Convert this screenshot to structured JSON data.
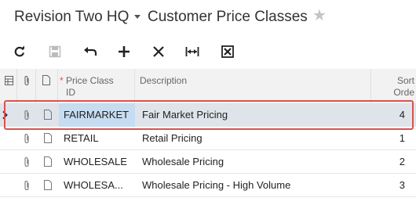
{
  "header": {
    "company": "Revision Two HQ",
    "screen_title": "Customer Price Classes"
  },
  "toolbar": {
    "buttons": [
      {
        "name": "refresh",
        "icon": "refresh-icon"
      },
      {
        "name": "save",
        "icon": "save-icon"
      },
      {
        "name": "undo",
        "icon": "undo-icon"
      },
      {
        "name": "add",
        "icon": "plus-icon"
      },
      {
        "name": "delete",
        "icon": "close-icon"
      },
      {
        "name": "fit-to-screen",
        "icon": "fit-width-icon"
      },
      {
        "name": "export-excel",
        "icon": "excel-icon"
      }
    ]
  },
  "grid": {
    "columns": {
      "price_class_required": "*",
      "price_class_id": "Price Class\nID",
      "description": "Description",
      "sort_order": "Sort\nOrde"
    },
    "rows": [
      {
        "id": "FAIRMARKET",
        "description": "Fair Market Pricing",
        "sort_order": "4",
        "selected": true
      },
      {
        "id": "RETAIL",
        "description": "Retail Pricing",
        "sort_order": "1",
        "selected": false
      },
      {
        "id": "WHOLESALE",
        "description": "Wholesale Pricing",
        "sort_order": "2",
        "selected": false
      },
      {
        "id": "WHOLESA...",
        "description": "Wholesale Pricing - High Volume",
        "sort_order": "3",
        "selected": false
      }
    ]
  },
  "colors": {
    "selected_row": "#dfe4ea",
    "selected_cell": "#c6dcf0",
    "highlight_border": "#d9534f",
    "required_marker": "#d9534f"
  }
}
